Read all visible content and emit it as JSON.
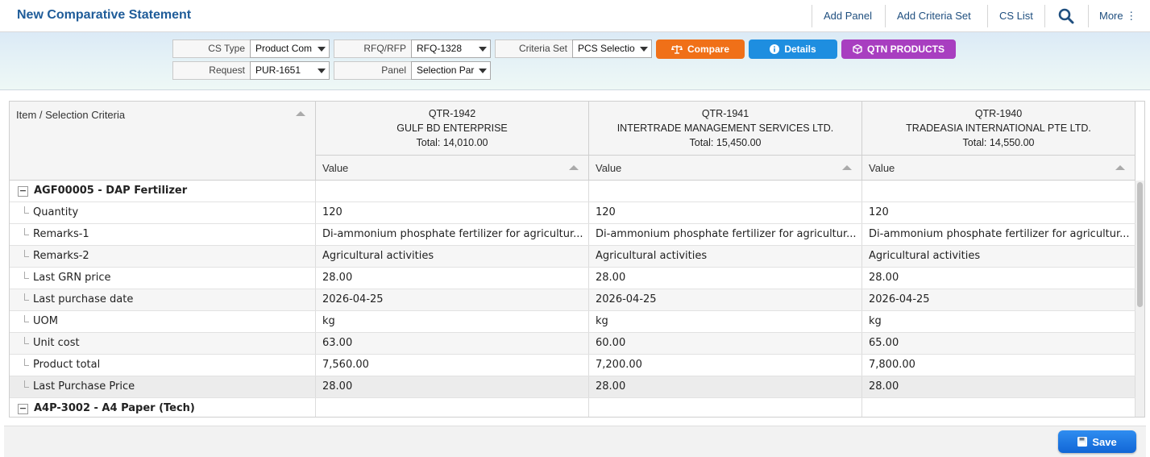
{
  "header": {
    "title": "New Comparative Statement",
    "actions": [
      "Add Panel",
      "Add Criteria Set",
      "CS List"
    ],
    "more_label": "More ⋮"
  },
  "filters": {
    "cs_type": {
      "label": "CS Type",
      "value": "Product Com"
    },
    "rfq": {
      "label": "RFQ/RFP",
      "value": "RFQ-1328"
    },
    "criteria_set": {
      "label": "Criteria Set",
      "value": "PCS Selectio"
    },
    "request": {
      "label": "Request",
      "value": "PUR-1651"
    },
    "panel": {
      "label": "Panel",
      "value": "Selection Par"
    },
    "buttons": {
      "compare": "Compare",
      "details": "Details",
      "qtn_products": "QTN PRODUCTS"
    },
    "colors": {
      "compare": "#f07018",
      "details": "#1e8ee0",
      "qtn": "#a83ec0"
    }
  },
  "grid": {
    "left_header": "Item / Selection Criteria",
    "value_header": "Value",
    "quotations": [
      {
        "code": "QTR-1942",
        "vendor": "GULF BD ENTERPRISE",
        "total": "Total: 14,010.00"
      },
      {
        "code": "QTR-1941",
        "vendor": "INTERTRADE MANAGEMENT SERVICES LTD.",
        "total": "Total: 15,450.00"
      },
      {
        "code": "QTR-1940",
        "vendor": "TRADEASIA INTERNATIONAL PTE LTD.",
        "total": "Total: 14,550.00"
      }
    ],
    "groups": [
      {
        "toggle": "−",
        "label": "AGF00005 - DAP Fertilizer",
        "rows": [
          {
            "label": "Quantity",
            "values": [
              "120",
              "120",
              "120"
            ]
          },
          {
            "label": "Remarks-1",
            "values": [
              "Di-ammonium phosphate fertilizer for agricultur...",
              "Di-ammonium phosphate fertilizer for agricultur...",
              "Di-ammonium phosphate fertilizer for agricultur..."
            ]
          },
          {
            "label": "Remarks-2",
            "values": [
              "Agricultural activities",
              "Agricultural activities",
              "Agricultural activities"
            ]
          },
          {
            "label": "Last GRN price",
            "values": [
              "28.00",
              "28.00",
              "28.00"
            ]
          },
          {
            "label": "Last purchase date",
            "values": [
              "2026-04-25",
              "2026-04-25",
              "2026-04-25"
            ]
          },
          {
            "label": "UOM",
            "values": [
              "kg",
              "kg",
              "kg"
            ]
          },
          {
            "label": "Unit cost",
            "values": [
              "63.00",
              "60.00",
              "65.00"
            ]
          },
          {
            "label": "Product total",
            "values": [
              "7,560.00",
              "7,200.00",
              "7,800.00"
            ]
          },
          {
            "label": "Last Purchase Price",
            "values": [
              "28.00",
              "28.00",
              "28.00"
            ]
          }
        ]
      },
      {
        "toggle": "−",
        "label": "A4P-3002 - A4 Paper (Tech)",
        "rows": []
      }
    ]
  },
  "footer": {
    "save_label": "Save"
  }
}
